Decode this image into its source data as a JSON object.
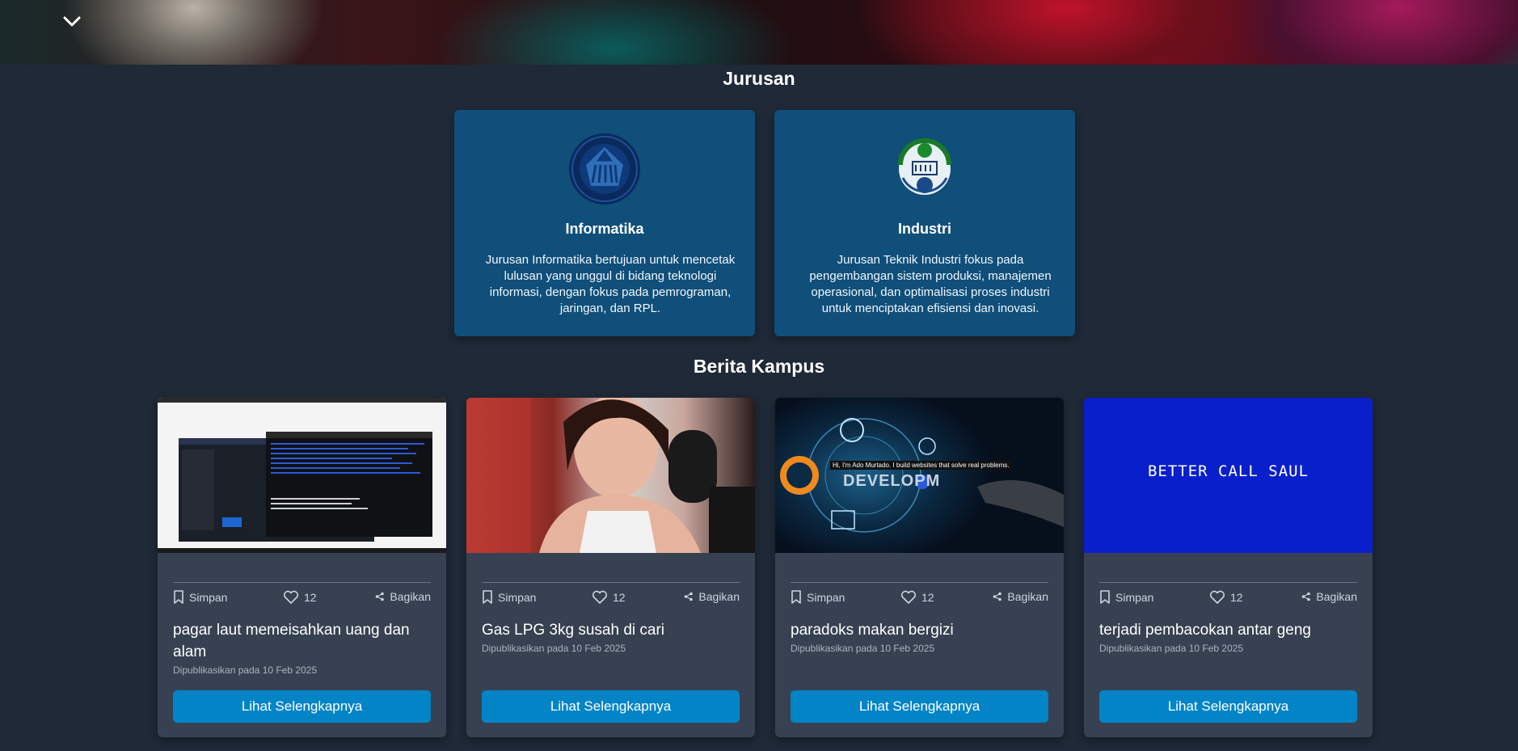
{
  "sections": {
    "jurusan_title": "Jurusan",
    "news_title": "Berita Kampus"
  },
  "departments": [
    {
      "name": "Informatika",
      "description": "Jurusan Informatika bertujuan untuk mencetak lulusan yang unggul di bidang teknologi informasi, dengan fokus pada pemrograman, jaringan, dan RPL.",
      "logo_icon": "informatika-logo-icon"
    },
    {
      "name": "Industri",
      "description": "Jurusan Teknik Industri fokus pada pengembangan sistem produksi, manajemen operasional, dan optimalisasi proses industri untuk menciptakan efisiensi dan inovasi.",
      "logo_icon": "industri-logo-icon"
    }
  ],
  "news": [
    {
      "title": "pagar laut memeisahkan uang dan alam",
      "date": "Dipublikasikan pada 10 Feb 2025",
      "save_label": "Simpan",
      "likes": "12",
      "share_label": "Bagikan",
      "button_label": "Lihat Selengkapnya"
    },
    {
      "title": "Gas LPG 3kg susah di cari",
      "date": "Dipublikasikan pada 10 Feb 2025",
      "save_label": "Simpan",
      "likes": "12",
      "share_label": "Bagikan",
      "button_label": "Lihat Selengkapnya"
    },
    {
      "title": "paradoks makan bergizi",
      "date": "Dipublikasikan pada 10 Feb 2025",
      "save_label": "Simpan",
      "likes": "12",
      "share_label": "Bagikan",
      "button_label": "Lihat Selengkapnya",
      "thumb_caption": "Hi, I'm Ado Murtado. I build websites that solve real problems.",
      "thumb_word": "DEVELOPM"
    },
    {
      "title": "terjadi pembacokan antar geng",
      "date": "Dipublikasikan pada 10 Feb 2025",
      "save_label": "Simpan",
      "likes": "12",
      "share_label": "Bagikan",
      "button_label": "Lihat Selengkapnya",
      "thumb_text": "BETTER CALL SAUL"
    }
  ],
  "colors": {
    "background": "#1f2937",
    "dept_card": "#0f4f7a",
    "news_card": "#374151",
    "button": "#0284c7",
    "thumb_blue": "#0a1fcc"
  }
}
